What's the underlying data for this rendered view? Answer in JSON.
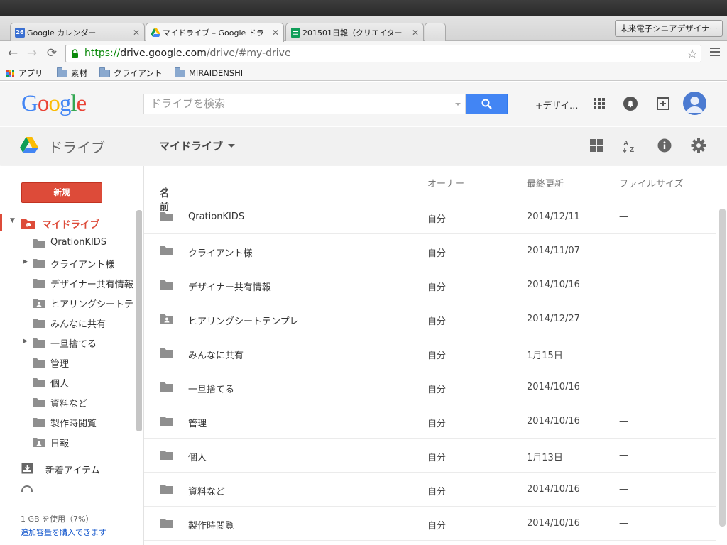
{
  "browser": {
    "tabs": [
      {
        "label": "Google カレンダー",
        "favicon": "calendar-favicon",
        "favicon_text": "26"
      },
      {
        "label": "マイドライブ – Google ドラ",
        "favicon": "drive-favicon"
      },
      {
        "label": "201501日報（クリエイター",
        "favicon": "sheets-favicon"
      }
    ],
    "profile_name": "未来電子シニアデザイナー",
    "url": {
      "scheme": "https://",
      "host": "drive.google.com",
      "path": "/drive/#my-drive"
    },
    "bookmarks": [
      "アプリ",
      "素材",
      "クライアント",
      "MIRAIDENSHI"
    ]
  },
  "google_bar": {
    "logo": "Google",
    "search_placeholder": "ドライブを検索",
    "plus_user": "+デザイ…"
  },
  "drive_header": {
    "app_title": "ドライブ",
    "location": "マイドライブ"
  },
  "sidebar": {
    "new_button": "新規",
    "my_drive": "マイドライブ",
    "folders": [
      {
        "label": "QrationKIDS",
        "expandable": false,
        "shared": false
      },
      {
        "label": "クライアント様",
        "expandable": true,
        "shared": false
      },
      {
        "label": "デザイナー共有情報",
        "expandable": false,
        "shared": false
      },
      {
        "label": "ヒアリングシートテ",
        "expandable": false,
        "shared": true
      },
      {
        "label": "みんなに共有",
        "expandable": false,
        "shared": false
      },
      {
        "label": "一旦捨てる",
        "expandable": true,
        "shared": false
      },
      {
        "label": "管理",
        "expandable": false,
        "shared": false
      },
      {
        "label": "個人",
        "expandable": false,
        "shared": false
      },
      {
        "label": "資料など",
        "expandable": false,
        "shared": false
      },
      {
        "label": "製作時閲覧",
        "expandable": false,
        "shared": false
      },
      {
        "label": "日報",
        "expandable": false,
        "shared": true
      }
    ],
    "incoming": "新着アイテム",
    "quota": "1 GB を使用（7%）",
    "buy_storage": "追加容量を購入できます"
  },
  "file_list": {
    "columns": {
      "name": "名前",
      "sort_indicator": "↑",
      "owner": "オーナー",
      "modified": "最終更新",
      "size": "ファイルサイズ"
    },
    "rows": [
      {
        "name": "QrationKIDS",
        "owner": "自分",
        "modified": "2014/12/11",
        "size": "—",
        "shared": false
      },
      {
        "name": "クライアント様",
        "owner": "自分",
        "modified": "2014/11/07",
        "size": "—",
        "shared": false
      },
      {
        "name": "デザイナー共有情報",
        "owner": "自分",
        "modified": "2014/10/16",
        "size": "—",
        "shared": false
      },
      {
        "name": "ヒアリングシートテンプレ",
        "owner": "自分",
        "modified": "2014/12/27",
        "size": "—",
        "shared": true
      },
      {
        "name": "みんなに共有",
        "owner": "自分",
        "modified": "1月15日",
        "size": "—",
        "shared": false
      },
      {
        "name": "一旦捨てる",
        "owner": "自分",
        "modified": "2014/10/16",
        "size": "—",
        "shared": false
      },
      {
        "name": "管理",
        "owner": "自分",
        "modified": "2014/10/16",
        "size": "—",
        "shared": false
      },
      {
        "name": "個人",
        "owner": "自分",
        "modified": "1月13日",
        "size": "—",
        "shared": false
      },
      {
        "name": "資料など",
        "owner": "自分",
        "modified": "2014/10/16",
        "size": "—",
        "shared": false
      },
      {
        "name": "製作時閲覧",
        "owner": "自分",
        "modified": "2014/10/16",
        "size": "—",
        "shared": false
      }
    ]
  },
  "colors": {
    "accent_red": "#dd4b39",
    "search_blue": "#4285f4",
    "folder_gray": "#8f8f8f",
    "link_blue": "#1155cc"
  }
}
